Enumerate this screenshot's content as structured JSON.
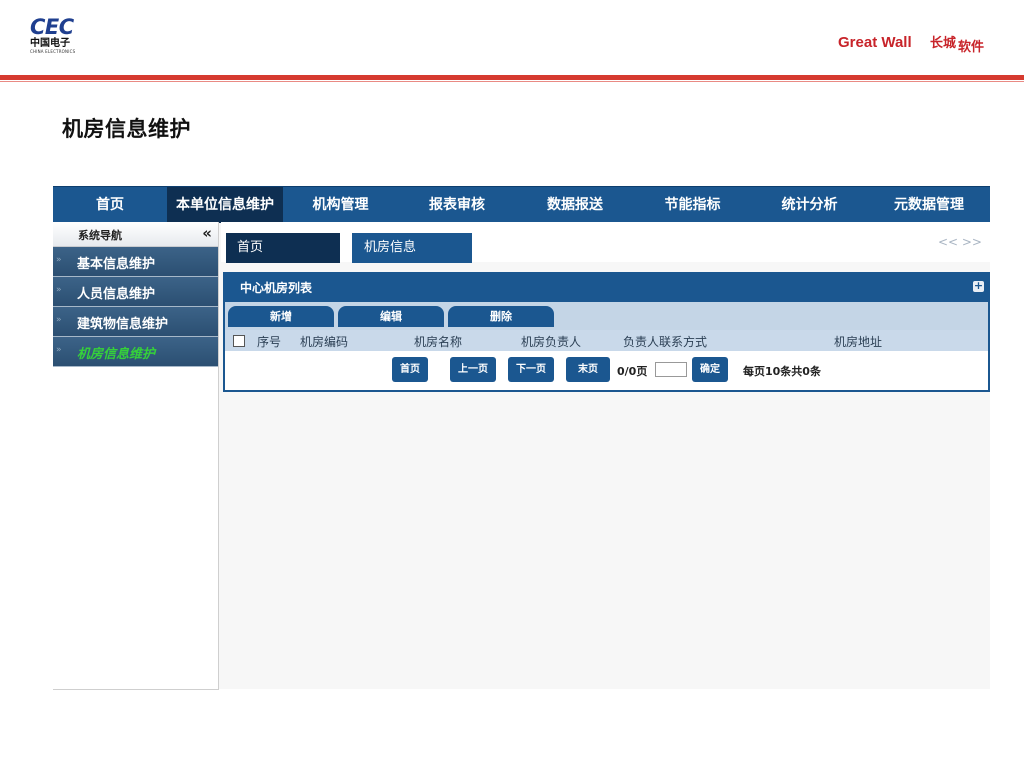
{
  "header": {
    "cec_logo": {
      "main": "CEC",
      "sub": "中国电子",
      "en": "CHINA ELECTRONICS"
    },
    "gw_logo": {
      "text": "Great Wall",
      "mark": "长城",
      "suffix": "软件"
    },
    "colors": {
      "brand_red": "#d63a2f",
      "navy": "#1b5790",
      "dark_navy": "#0e2f52"
    }
  },
  "page_title": "机房信息维护",
  "topnav": {
    "items": [
      {
        "label": "首页"
      },
      {
        "label": "本单位信息维护",
        "active": true
      },
      {
        "label": "机构管理"
      },
      {
        "label": "报表审核"
      },
      {
        "label": "数据报送"
      },
      {
        "label": "节能指标"
      },
      {
        "label": "统计分析"
      },
      {
        "label": "元数据管理"
      }
    ]
  },
  "sidebar": {
    "title": "系统导航",
    "collapse_icon": "«",
    "items": [
      {
        "label": "基本信息维护"
      },
      {
        "label": "人员信息维护"
      },
      {
        "label": "建筑物信息维护"
      },
      {
        "label": "机房信息维护",
        "active": true
      }
    ]
  },
  "tabs": {
    "items": [
      {
        "label": "首页"
      },
      {
        "label": "机房信息"
      }
    ],
    "scroll_icons": "<<  >>"
  },
  "panel": {
    "title": "中心机房列表",
    "plus_icon": "+",
    "toolbar": {
      "add": "新增",
      "edit": "编辑",
      "delete": "删除"
    },
    "columns": [
      "序号",
      "机房编码",
      "机房名称",
      "机房负责人",
      "负责人联系方式",
      "机房地址"
    ],
    "pager": {
      "first": "首页",
      "prev": "上一页",
      "next": "下一页",
      "last": "末页",
      "page_info": "0/0页",
      "confirm": "确定",
      "summary": "每页10条共0条"
    }
  }
}
